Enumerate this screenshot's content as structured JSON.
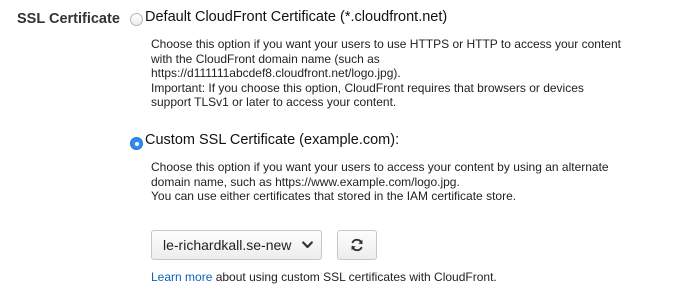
{
  "field": {
    "label": "SSL Certificate"
  },
  "options": [
    {
      "title": "Default CloudFront Certificate (*.cloudfront.net)",
      "selected": false,
      "description": [
        "Choose this option if you want your users to use HTTPS or HTTP to access your content",
        "with the CloudFront domain name (such as",
        "https://d111111abcdef8.cloudfront.net/logo.jpg).",
        "Important: If you choose this option, CloudFront requires that browsers or devices",
        "support TLSv1 or later to access your content."
      ]
    },
    {
      "title": "Custom SSL Certificate (example.com):",
      "selected": true,
      "description": [
        "Choose this option if you want your users to access your content by using an alternate",
        "domain name, such as https://www.example.com/logo.jpg.",
        "You can use either certificates that stored in the IAM certificate store."
      ]
    }
  ],
  "certificate_select": {
    "value": "le-richardkall.se-new",
    "icon": "chevron-down-icon"
  },
  "refresh_button": {
    "icon": "refresh-icon"
  },
  "footer": {
    "link_text": "Learn more",
    "rest_text": " about using custom SSL certificates with CloudFront."
  },
  "colors": {
    "radio_selected": "#2f8bf0",
    "link": "#0b63b7"
  }
}
